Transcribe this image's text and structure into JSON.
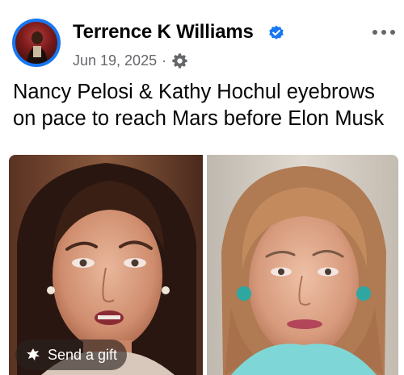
{
  "post": {
    "author": "Terrence K Williams",
    "date": "Jun 19, 2025",
    "separator": "·",
    "caption": "Nancy Pelosi & Kathy Hochul eyebrows on pace to reach Mars before Elon Musk",
    "icons": {
      "verified": "verified-badge-icon",
      "audience": "gear-icon",
      "more": "more-options-icon",
      "gift": "gift-icon"
    }
  },
  "actions": {
    "send_gift_label": "Send a gift"
  },
  "colors": {
    "accent": "#1877f2",
    "secondary_text": "#65676b",
    "primary_text": "#050505"
  }
}
